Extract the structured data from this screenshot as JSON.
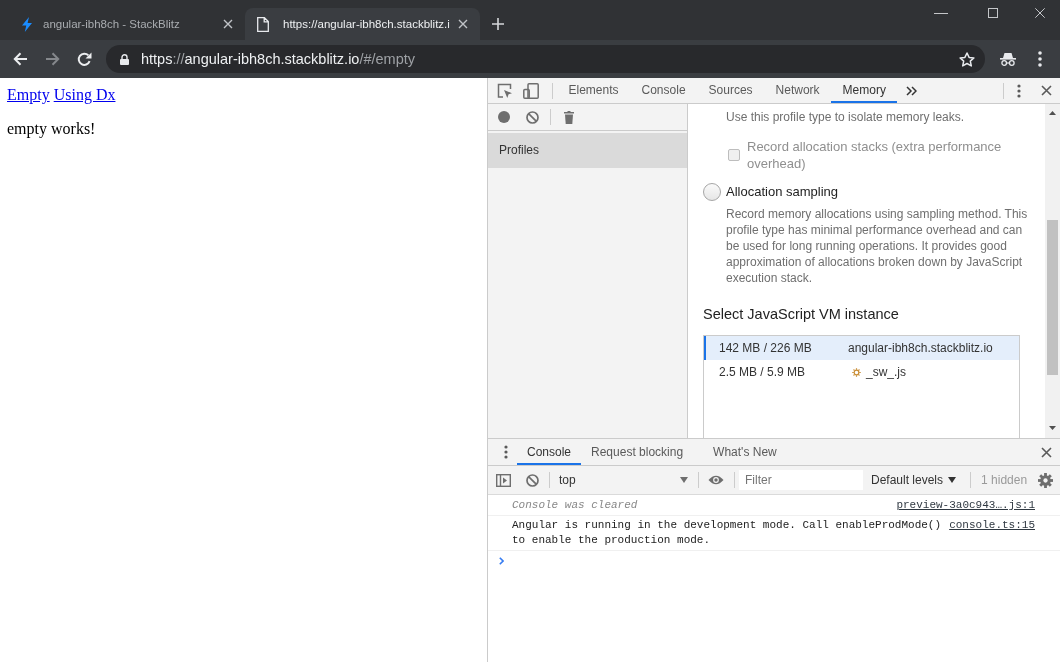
{
  "browser": {
    "tabs": [
      {
        "kind": "bolt",
        "title": "angular-ibh8ch - StackBlitz",
        "selected": false
      },
      {
        "kind": "page",
        "title": "https://angular-ibh8ch.stackblitz.i",
        "selected": true
      }
    ],
    "nav_buttons": [
      {
        "kind": "back",
        "disabled": false
      },
      {
        "kind": "forward",
        "disabled": true
      },
      {
        "kind": "reload",
        "disabled": false
      }
    ],
    "address_bar": {
      "url_parts": [
        {
          "kind": "scheme",
          "text": "https"
        },
        {
          "kind": "separator",
          "text": "://"
        },
        {
          "kind": "host",
          "text": "angular-ibh8ch.stackblitz.io"
        },
        {
          "kind": "path",
          "text": "/#/empty"
        }
      ]
    }
  },
  "page": {
    "links": [
      "Empty",
      "Using Dx"
    ],
    "text": "empty works!"
  },
  "devtools": {
    "tabs": [
      {
        "label": "Elements",
        "selected": false
      },
      {
        "label": "Console",
        "selected": false
      },
      {
        "label": "Sources",
        "selected": false
      },
      {
        "label": "Network",
        "selected": false
      },
      {
        "label": "Memory",
        "selected": true
      }
    ],
    "memory": {
      "sidebar_header": "Profiles",
      "intro": "Use this profile type to isolate memory leaks.",
      "allocation_stacks": {
        "label": "Record allocation stacks (extra performance overhead)",
        "checked": false,
        "disabled": true
      },
      "profile_types": [
        {
          "label": "Allocation sampling",
          "selected": false,
          "description": "Record memory allocations using sampling method. This profile type has minimal performance overhead and can be used for long running operations. It provides good approximation of allocations broken down by JavaScript execution stack."
        }
      ],
      "vm_heading": "Select JavaScript VM instance",
      "vm_instances": [
        {
          "kind": "page",
          "memory": "142 MB / 226 MB",
          "name": "angular-ibh8ch.stackblitz.io",
          "selected": true
        },
        {
          "kind": "worker",
          "memory": "2.5 MB / 5.9 MB",
          "name": "_sw_.js",
          "selected": false
        }
      ]
    }
  },
  "drawer": {
    "tabs": [
      {
        "label": "Console",
        "selected": true
      },
      {
        "label": "Request blocking",
        "selected": false
      },
      {
        "label": "What's New",
        "selected": false
      }
    ],
    "context": "top",
    "filter": {
      "placeholder": "Filter"
    },
    "levels": "Default levels",
    "hidden_count": "1 hidden",
    "messages": [
      {
        "kind": "info",
        "text": "Console was cleared",
        "source": "preview-3a0c943….js:1"
      },
      {
        "kind": "log",
        "text": "Angular is running in the development mode. Call enableProdMode() to enable the production mode.",
        "source": "console.ts:15"
      }
    ]
  }
}
